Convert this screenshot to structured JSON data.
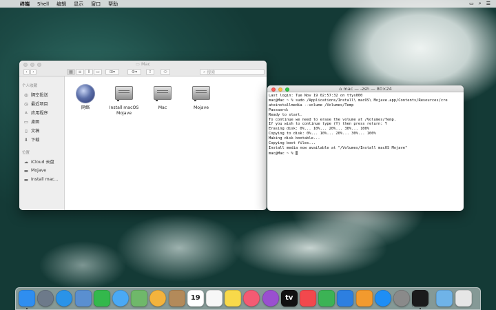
{
  "menubar": {
    "apple": "",
    "items": [
      "终端",
      "Shell",
      "编辑",
      "显示",
      "窗口",
      "帮助"
    ],
    "right_icons": [
      "airplay-icon",
      "search-icon",
      "control-center-icon"
    ]
  },
  "finder": {
    "title": "Mac",
    "search_placeholder": "搜索",
    "sidebar": {
      "favorites_header": "个人收藏",
      "favorites": [
        {
          "label": "隔空投送",
          "icon": "airdrop-icon"
        },
        {
          "label": "最近项目",
          "icon": "clock-icon"
        },
        {
          "label": "应用程序",
          "icon": "apps-icon"
        },
        {
          "label": "桌面",
          "icon": "desktop-icon"
        },
        {
          "label": "文稿",
          "icon": "document-icon"
        },
        {
          "label": "下载",
          "icon": "download-icon"
        }
      ],
      "locations_header": "位置",
      "locations": [
        {
          "label": "iCloud 云盘",
          "icon": "cloud-icon"
        },
        {
          "label": "Mojave",
          "icon": "disk-icon"
        },
        {
          "label": "Install mac...",
          "icon": "disk-icon"
        }
      ]
    },
    "items": [
      {
        "label_line1": "网络",
        "label_line2": "",
        "icon": "network-globe-icon"
      },
      {
        "label_line1": "Install macOS",
        "label_line2": "Mojave",
        "icon": "hard-disk-icon"
      },
      {
        "label_line1": "Mac",
        "label_line2": "",
        "icon": "hard-disk-icon"
      },
      {
        "label_line1": "Mojave",
        "label_line2": "",
        "icon": "hard-disk-icon"
      }
    ]
  },
  "terminal": {
    "title": "mac — -zsh — 80×24",
    "lines": [
      "Last login: Tue Nov 19 02:57:32 on ttys000",
      "mac@Mac ~ % sudo /Applications/Install\\ macOS\\ Mojave.app/Contents/Resources/cre",
      "ateinstallmedia --volume /Volumes/Temp",
      "Password:",
      "Ready to start.",
      "To continue we need to erase the volume at /Volumes/Temp.",
      "If you wish to continue type (Y) then press return: Y",
      "Erasing disk: 0%... 10%... 20%... 30%... 100%",
      "Copying to disk: 0%... 10%... 20%... 30%... 100%",
      "Making disk bootable...",
      "Copying boot files...",
      "Install media now available at \"/Volumes/Install macOS Mojave\"",
      "mac@Mac ~ % "
    ]
  },
  "dock": {
    "items": [
      {
        "name": "finder-icon",
        "color": "#2f8ef0",
        "running": true
      },
      {
        "name": "launchpad-icon",
        "color": "#6d7a8a",
        "running": false
      },
      {
        "name": "safari-icon",
        "color": "#2a93e8",
        "running": false
      },
      {
        "name": "preview-icon",
        "color": "#5a8fd0",
        "running": false
      },
      {
        "name": "facetime-icon",
        "color": "#33b84c",
        "running": false
      },
      {
        "name": "messages-icon",
        "color": "#4aa9f5",
        "running": false
      },
      {
        "name": "maps-icon",
        "color": "#6fb86a",
        "running": false
      },
      {
        "name": "photos-icon",
        "color": "#f3b33d",
        "running": false
      },
      {
        "name": "contacts-icon",
        "color": "#b38a5a",
        "running": false
      },
      {
        "name": "calendar-icon",
        "color": "#ffffff",
        "running": false,
        "text": "19"
      },
      {
        "name": "reminders-icon",
        "color": "#f7f7f7",
        "running": false
      },
      {
        "name": "notes-icon",
        "color": "#f8d94a",
        "running": false
      },
      {
        "name": "music-icon",
        "color": "#f45b73",
        "running": false
      },
      {
        "name": "podcasts-icon",
        "color": "#9a4fd0",
        "running": false
      },
      {
        "name": "apple-tv-icon",
        "color": "#111111",
        "running": false,
        "text": "tv"
      },
      {
        "name": "news-icon",
        "color": "#f2484d",
        "running": false
      },
      {
        "name": "numbers-icon",
        "color": "#3cb355",
        "running": false
      },
      {
        "name": "keynote-icon",
        "color": "#2d7fe0",
        "running": false
      },
      {
        "name": "pages-icon",
        "color": "#f29a2e",
        "running": false
      },
      {
        "name": "app-store-icon",
        "color": "#1e8ef5",
        "running": false
      },
      {
        "name": "system-preferences-icon",
        "color": "#8a8a8a",
        "running": false
      },
      {
        "name": "terminal-icon",
        "color": "#1b1b1b",
        "running": true
      },
      {
        "name": "downloads-folder-icon",
        "color": "#6fb3e8",
        "running": false
      },
      {
        "name": "trash-icon",
        "color": "#e6e6e6",
        "running": false
      }
    ]
  }
}
